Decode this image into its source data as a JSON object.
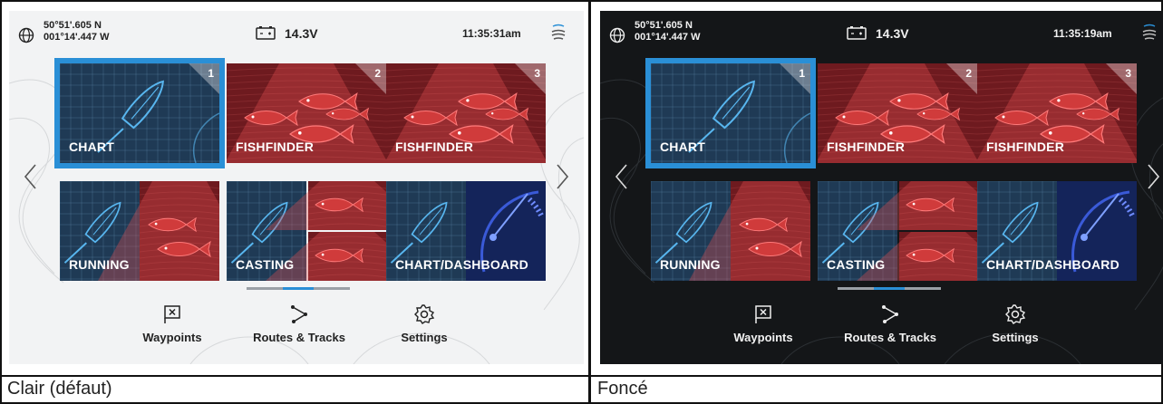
{
  "captions": {
    "light": "Clair (défaut)",
    "dark": "Foncé"
  },
  "status": {
    "light": {
      "lat": "50°51'.605 N",
      "lon": "001°14'.447 W",
      "voltage": "14.3V",
      "time": "11:35:31am"
    },
    "dark": {
      "lat": "50°51'.605 N",
      "lon": "001°14'.447 W",
      "voltage": "14.3V",
      "time": "11:35:19am"
    }
  },
  "tiles": [
    {
      "label": "CHART",
      "number": "1",
      "kind": "chart",
      "selected": true
    },
    {
      "label": "FISHFINDER",
      "number": "2",
      "kind": "fish"
    },
    {
      "label": "FISHFINDER",
      "number": "3",
      "kind": "fish"
    },
    {
      "label": "RUNNING",
      "kind": "chart-fish"
    },
    {
      "label": "CASTING",
      "kind": "chart-fish2"
    },
    {
      "label": "CHART/DASHBOARD",
      "kind": "chart-dash"
    }
  ],
  "bottom_nav": {
    "waypoints": "Waypoints",
    "routes": "Routes & Tracks",
    "settings": "Settings"
  },
  "colors": {
    "accent": "#2a8fd6",
    "chart_bg": "#1f3a55",
    "fish_bg": "#7a1d22",
    "dash_bg": "#14245a"
  }
}
